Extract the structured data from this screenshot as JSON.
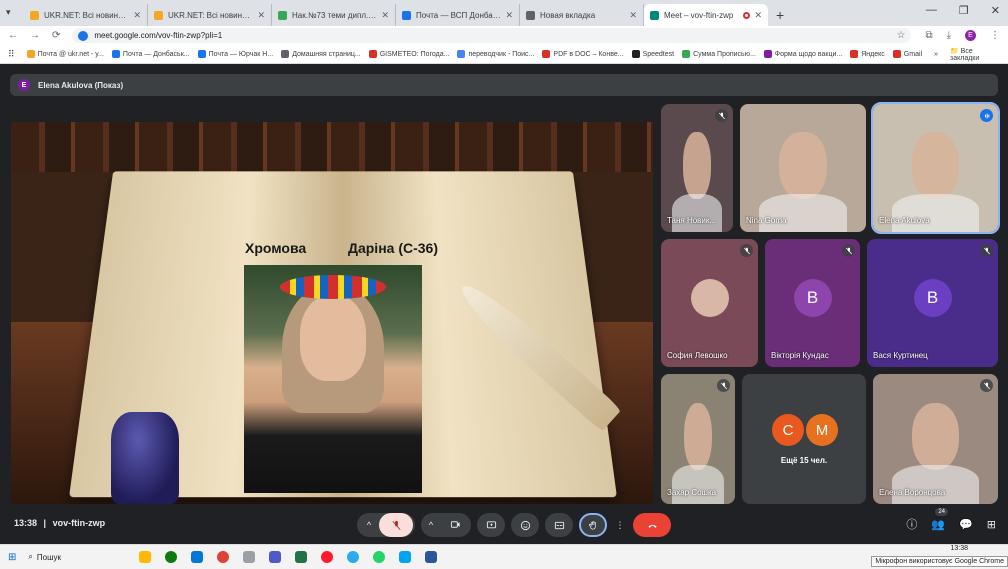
{
  "browser": {
    "tabs": [
      {
        "title": "UKR.NET: Всі новини України, о",
        "color": "#f5a623"
      },
      {
        "title": "UKR.NET: Всі новини України, о",
        "color": "#f5a623"
      },
      {
        "title": "Нак.№73 теми дипл. проектів",
        "color": "#34a853"
      },
      {
        "title": "Почта — ВСП Донбаський аг",
        "color": "#1a73e8"
      },
      {
        "title": "Новая вкладка",
        "color": "#5f6368"
      },
      {
        "title": "Meet – vov-ftin-zwp",
        "color": "#00897b",
        "active": true
      }
    ],
    "new_tab": "+",
    "url": "meet.google.com/vov-ftin-zwp?pli=1",
    "profile_initial": "E",
    "bookmarks": [
      {
        "label": "Почта @ ukr.net - у...",
        "color": "#f5a623"
      },
      {
        "label": "Почта — Донбаськ...",
        "color": "#1a73e8"
      },
      {
        "label": "Почта — Юрчак Н...",
        "color": "#1a73e8"
      },
      {
        "label": "Домашняя страниц...",
        "color": "#5f6368"
      },
      {
        "label": "GISMETEO: Погода...",
        "color": "#d93025"
      },
      {
        "label": "переводчик - Поис...",
        "color": "#4285f4"
      },
      {
        "label": "PDF в DOC – Конве...",
        "color": "#d93025"
      },
      {
        "label": "Speedtest",
        "color": "#202124"
      },
      {
        "label": "Сумма Прописью...",
        "color": "#34a853"
      },
      {
        "label": "Форма щодо вакци...",
        "color": "#7b1fa2"
      },
      {
        "label": "Яндекс",
        "color": "#d93025"
      },
      {
        "label": "Gmail",
        "color": "#d93025"
      }
    ],
    "more_bookmarks": "»",
    "all_bookmarks": "Все закладки"
  },
  "meet": {
    "presenter_label": "Elena Akulova (Показ)",
    "presenter_initial": "E",
    "slide": {
      "left_text": "Хромова",
      "right_text": "Даріна (С-36)"
    },
    "tiles": [
      {
        "name": "Таня Новик...",
        "muted": true,
        "bg": "#5a4a4e",
        "kind": "video"
      },
      {
        "name": "Nina Goma",
        "muted": false,
        "bg": "#b8a89a",
        "kind": "video"
      },
      {
        "name": "Elena Akulova",
        "muted": false,
        "bg": "#c9bfb0",
        "kind": "video",
        "speaking": true
      },
      {
        "name": "София Левошко",
        "muted": true,
        "bg": "#7a4a58",
        "kind": "photo",
        "avatar_color": "#d9b7a7"
      },
      {
        "name": "Вікторія Кундас",
        "muted": true,
        "bg": "#6a2e78",
        "kind": "avatar",
        "initial": "В",
        "avatar_color": "#8e44ad"
      },
      {
        "name": "Вася Куртинец",
        "muted": true,
        "bg": "#4a2d8a",
        "kind": "avatar",
        "initial": "В",
        "avatar_color": "#6a3fc1"
      },
      {
        "name": "Захар Сошка",
        "muted": true,
        "bg": "#8a8272",
        "kind": "video"
      },
      {
        "name": "",
        "muted": false,
        "bg": "#3c4043",
        "kind": "more",
        "more_label": "Ещё 15 чел.",
        "initials": [
          "С",
          "М"
        ]
      },
      {
        "name": "Елена Воронцова",
        "muted": true,
        "bg": "#9b8a80",
        "kind": "video"
      }
    ],
    "time": "13:38",
    "meeting_code": "vov-ftin-zwp",
    "participants_count": "24"
  },
  "taskbar": {
    "search": "Пошук",
    "clock_time": "13:38",
    "tooltip": "Мікрофон використовує Google Chrome"
  }
}
